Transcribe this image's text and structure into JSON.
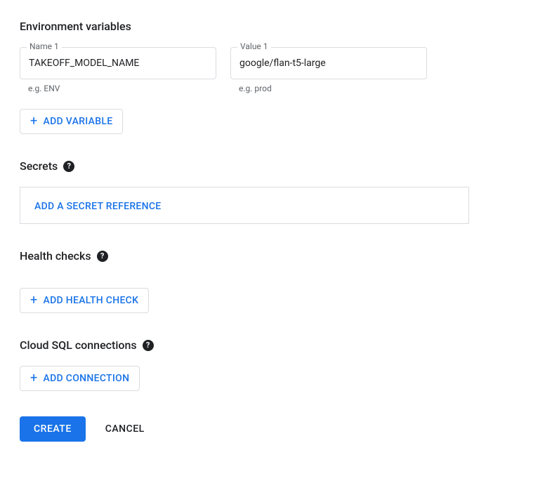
{
  "env": {
    "title": "Environment variables",
    "name_label": "Name 1",
    "name_value": "TAKEOFF_MODEL_NAME",
    "name_hint": "e.g. ENV",
    "value_label": "Value 1",
    "value_value": "google/flan-t5-large",
    "value_hint": "e.g. prod",
    "add_btn": "ADD VARIABLE"
  },
  "secrets": {
    "title": "Secrets",
    "add_btn": "ADD A SECRET REFERENCE"
  },
  "health": {
    "title": "Health checks",
    "add_btn": "ADD HEALTH CHECK"
  },
  "sql": {
    "title": "Cloud SQL connections",
    "add_btn": "ADD CONNECTION"
  },
  "footer": {
    "create": "CREATE",
    "cancel": "CANCEL"
  }
}
